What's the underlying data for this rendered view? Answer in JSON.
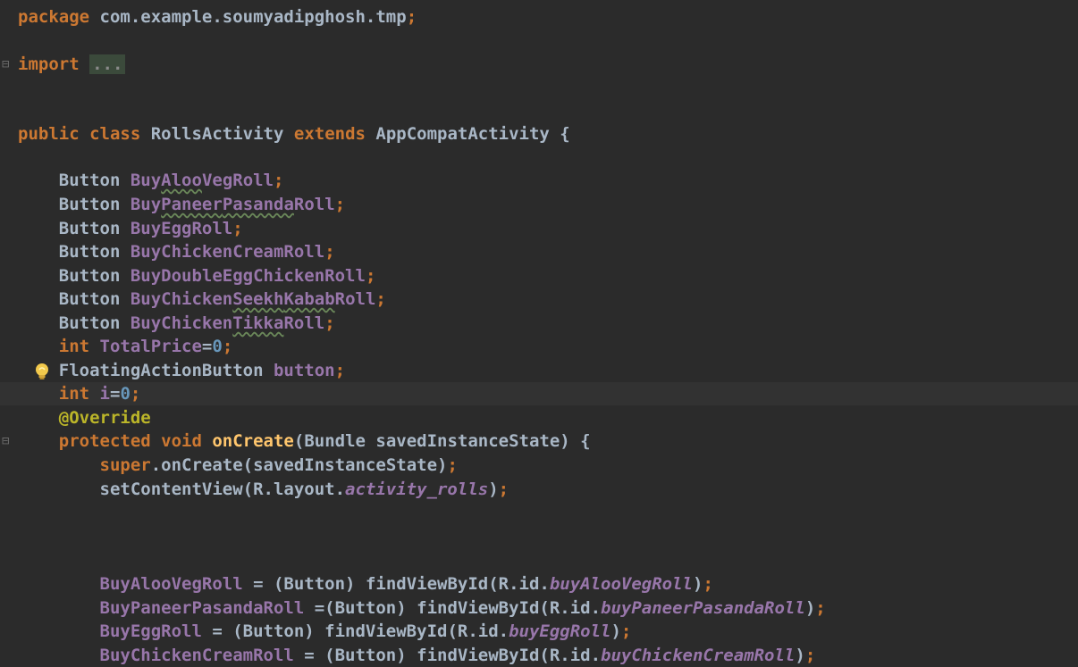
{
  "editor": {
    "lines": [
      {
        "id": "l1",
        "tokens": [
          {
            "t": "package ",
            "c": "kw"
          },
          {
            "t": "com.example.soumyadipghosh.tmp",
            "c": ""
          },
          {
            "t": ";",
            "c": "kw"
          }
        ]
      },
      {
        "id": "l2",
        "tokens": [
          {
            "t": "import ",
            "c": "kw"
          },
          {
            "t": "...",
            "c": "fold"
          }
        ],
        "fold": true
      },
      {
        "id": "l3",
        "tokens": []
      },
      {
        "id": "l4",
        "tokens": [
          {
            "t": "public class ",
            "c": "kw"
          },
          {
            "t": "RollsActivity ",
            "c": ""
          },
          {
            "t": "extends ",
            "c": "kw"
          },
          {
            "t": "AppCompatActivity {",
            "c": ""
          }
        ]
      },
      {
        "id": "l5",
        "tokens": []
      },
      {
        "id": "l6",
        "tokens": [
          {
            "t": "    Button ",
            "c": ""
          },
          {
            "t": "BuyAlooVegRoll",
            "c": "fld"
          },
          {
            "t": ";",
            "c": "kw"
          }
        ]
      },
      {
        "id": "l7",
        "tokens": [
          {
            "t": "    Button ",
            "c": ""
          },
          {
            "t": "BuyPaneerPasandaRoll",
            "c": "fld"
          },
          {
            "t": ";",
            "c": "kw"
          }
        ]
      },
      {
        "id": "l8",
        "tokens": [
          {
            "t": "    Button ",
            "c": ""
          },
          {
            "t": "BuyEggRoll",
            "c": "fld"
          },
          {
            "t": ";",
            "c": "kw"
          }
        ]
      },
      {
        "id": "l9",
        "tokens": [
          {
            "t": "    Button ",
            "c": ""
          },
          {
            "t": "BuyChickenCreamRoll",
            "c": "fld"
          },
          {
            "t": ";",
            "c": "kw"
          }
        ]
      },
      {
        "id": "l10",
        "tokens": [
          {
            "t": "    Button ",
            "c": ""
          },
          {
            "t": "BuyDoubleEggChickenRoll",
            "c": "fld"
          },
          {
            "t": ";",
            "c": "kw"
          }
        ]
      },
      {
        "id": "l11",
        "tokens": [
          {
            "t": "    Button ",
            "c": ""
          },
          {
            "t": "BuyChickenSeekhKababRoll",
            "c": "fld"
          },
          {
            "t": ";",
            "c": "kw"
          }
        ]
      },
      {
        "id": "l12",
        "tokens": [
          {
            "t": "    Button ",
            "c": ""
          },
          {
            "t": "BuyChickenTikkaRoll",
            "c": "fld"
          },
          {
            "t": ";",
            "c": "kw"
          }
        ]
      },
      {
        "id": "l13",
        "tokens": [
          {
            "t": "    ",
            "c": ""
          },
          {
            "t": "int ",
            "c": "kw"
          },
          {
            "t": "TotalPrice",
            "c": "fld"
          },
          {
            "t": "=",
            "c": ""
          },
          {
            "t": "0",
            "c": "num"
          },
          {
            "t": ";",
            "c": "kw"
          }
        ]
      },
      {
        "id": "l14",
        "tokens": [
          {
            "t": "    FloatingActionButton ",
            "c": ""
          },
          {
            "t": "button",
            "c": "fld"
          },
          {
            "t": ";",
            "c": "kw"
          }
        ],
        "bulb": true
      },
      {
        "id": "l15",
        "tokens": [
          {
            "t": "    ",
            "c": ""
          },
          {
            "t": "int ",
            "c": "kw"
          },
          {
            "t": "i",
            "c": "fld"
          },
          {
            "t": "=",
            "c": ""
          },
          {
            "t": "0",
            "c": "num"
          },
          {
            "t": ";",
            "c": "kw"
          }
        ],
        "caret": true
      },
      {
        "id": "l16",
        "tokens": [
          {
            "t": "    ",
            "c": ""
          },
          {
            "t": "@Override",
            "c": "ann"
          }
        ]
      },
      {
        "id": "l17",
        "tokens": [
          {
            "t": "    ",
            "c": ""
          },
          {
            "t": "protected void ",
            "c": "kw"
          },
          {
            "t": "onCreate",
            "c": "fn"
          },
          {
            "t": "(Bundle savedInstanceState) {",
            "c": ""
          }
        ],
        "fold": true
      },
      {
        "id": "l18",
        "tokens": [
          {
            "t": "        ",
            "c": ""
          },
          {
            "t": "super",
            "c": "kw"
          },
          {
            "t": ".onCreate(savedInstanceState)",
            "c": ""
          },
          {
            "t": ";",
            "c": "kw"
          }
        ]
      },
      {
        "id": "l19",
        "tokens": [
          {
            "t": "        setContentView(R.layout.",
            "c": ""
          },
          {
            "t": "activity_rolls",
            "c": "ital"
          },
          {
            "t": ")",
            "c": ""
          },
          {
            "t": ";",
            "c": "kw"
          }
        ]
      },
      {
        "id": "l20",
        "tokens": []
      },
      {
        "id": "l21",
        "tokens": []
      },
      {
        "id": "l22",
        "tokens": []
      },
      {
        "id": "l23",
        "tokens": [
          {
            "t": "        ",
            "c": ""
          },
          {
            "t": "BuyAlooVegRoll",
            "c": "fld"
          },
          {
            "t": " = (Button) findViewById(R.id.",
            "c": ""
          },
          {
            "t": "buyAlooVegRoll",
            "c": "ital"
          },
          {
            "t": ")",
            "c": ""
          },
          {
            "t": ";",
            "c": "kw"
          }
        ]
      },
      {
        "id": "l24",
        "tokens": [
          {
            "t": "        ",
            "c": ""
          },
          {
            "t": "BuyPaneerPasandaRoll",
            "c": "fld"
          },
          {
            "t": " =(Button) findViewById(R.id.",
            "c": ""
          },
          {
            "t": "buyPaneerPasandaRoll",
            "c": "ital"
          },
          {
            "t": ")",
            "c": ""
          },
          {
            "t": ";",
            "c": "kw"
          }
        ]
      },
      {
        "id": "l25",
        "tokens": [
          {
            "t": "        ",
            "c": ""
          },
          {
            "t": "BuyEggRoll",
            "c": "fld"
          },
          {
            "t": " = (Button) findViewById(R.id.",
            "c": ""
          },
          {
            "t": "buyEggRoll",
            "c": "ital"
          },
          {
            "t": ")",
            "c": ""
          },
          {
            "t": ";",
            "c": "kw"
          }
        ]
      },
      {
        "id": "l26",
        "tokens": [
          {
            "t": "        ",
            "c": ""
          },
          {
            "t": "BuyChickenCreamRoll",
            "c": "fld"
          },
          {
            "t": " = (Button) findViewById(R.id.",
            "c": ""
          },
          {
            "t": "buyChickenCreamRoll",
            "c": "ital"
          },
          {
            "t": ")",
            "c": ""
          },
          {
            "t": ";",
            "c": "kw"
          }
        ]
      }
    ]
  },
  "colors": {
    "background": "#2b2b2b",
    "keyword": "#cc7832",
    "field": "#9876aa",
    "text": "#a9b7c6",
    "number": "#6897bb",
    "annotation": "#bbb529",
    "method": "#ffc66d"
  },
  "icons": {
    "intention": "lightbulb-icon",
    "fold": "fold-marker-icon"
  }
}
